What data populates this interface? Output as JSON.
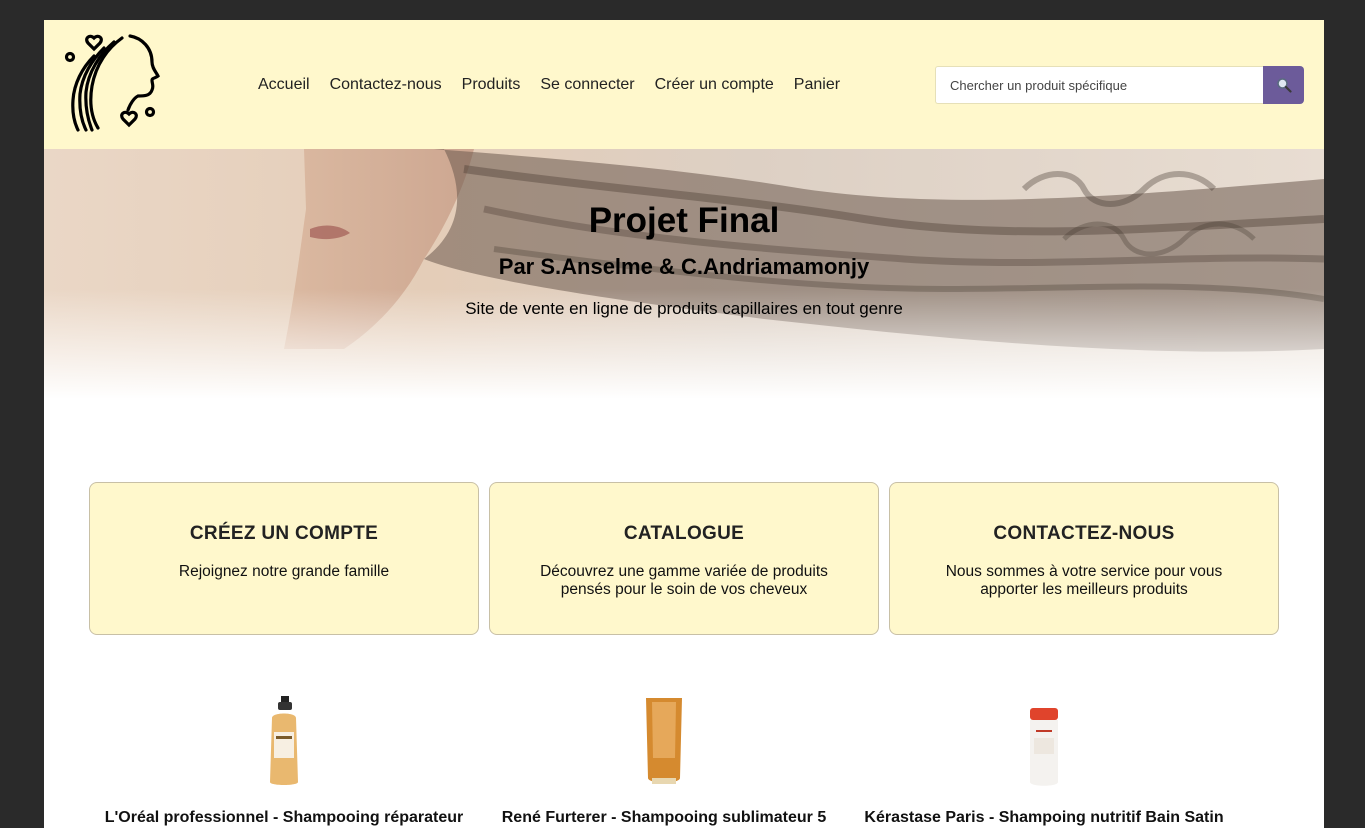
{
  "header": {
    "nav": [
      "Accueil",
      "Contactez-nous",
      "Produits",
      "Se connecter",
      "Créer un compte",
      "Panier"
    ],
    "search_placeholder": "Chercher un produit spécifique",
    "search_icon": "magnifier-icon"
  },
  "hero": {
    "title": "Projet Final",
    "subtitle": "Par S.Anselme & C.Andriamamonjy",
    "description": "Site de vente en ligne de produits capillaires en tout genre"
  },
  "cards": [
    {
      "title": "CRÉEZ UN COMPTE",
      "text": "Rejoignez notre grande famille"
    },
    {
      "title": "CATALOGUE",
      "text": "Découvrez une gamme variée de produits pensés pour le soin de vos cheveux"
    },
    {
      "title": "CONTACTEZ-NOUS",
      "text": "Nous sommes à votre service pour vous apporter les meilleurs produits"
    }
  ],
  "products": [
    {
      "name": "L'Oréal professionnel - Shampooing réparateur"
    },
    {
      "name": "René Furterer - Shampooing sublimateur 5"
    },
    {
      "name": "Kérastase Paris - Shampoing nutritif Bain Satin"
    }
  ],
  "colors": {
    "header_bg": "#fff8cc",
    "search_button": "#6c5b9a",
    "card_bg": "#fff8cc"
  }
}
